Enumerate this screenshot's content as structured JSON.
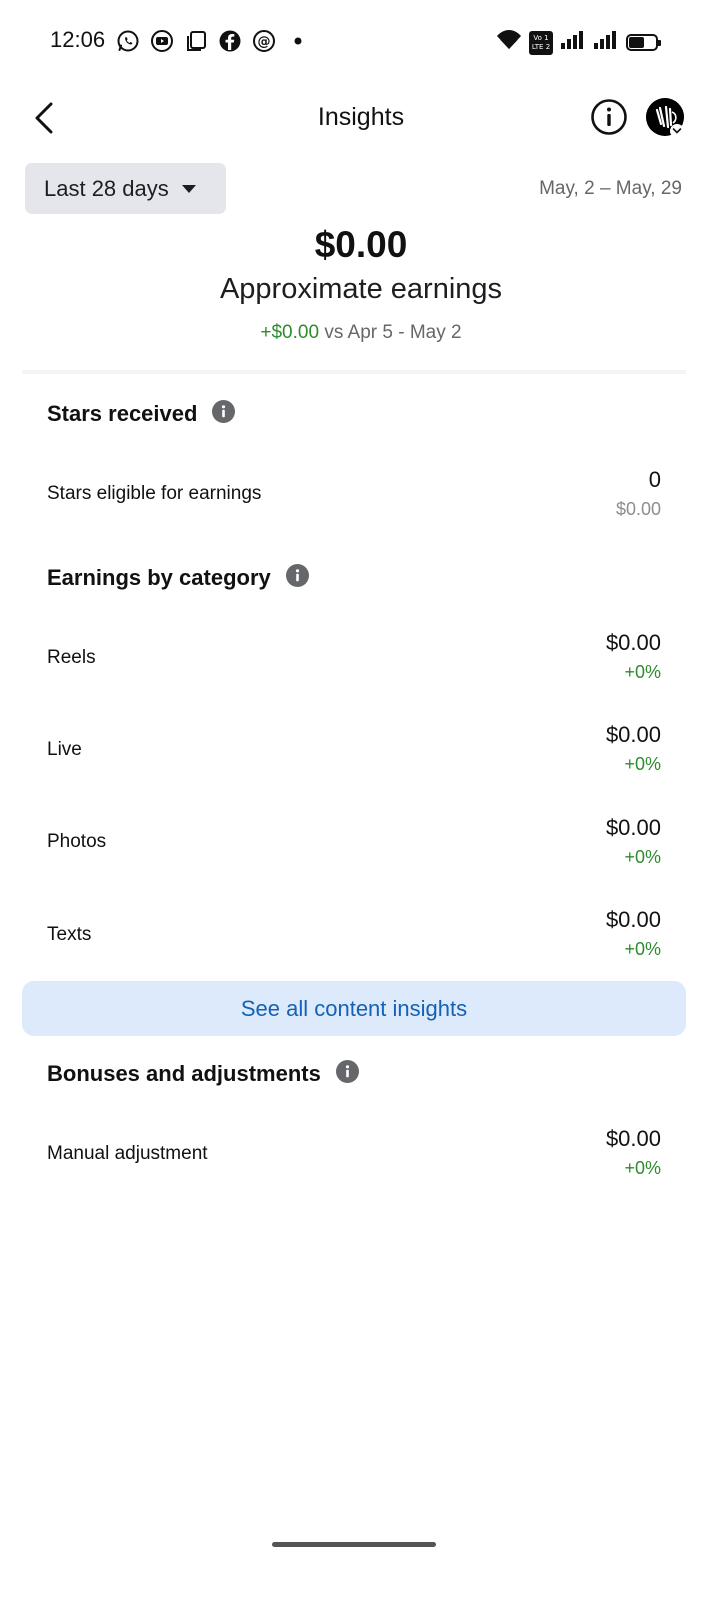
{
  "status_bar": {
    "time": "12:06",
    "left_icons": [
      "whatsapp-icon",
      "youtube-icon",
      "copy-icon",
      "facebook-icon",
      "threads-icon",
      "dot-icon"
    ],
    "right_icons": [
      "wifi-icon",
      "volte-icon",
      "signal-icon",
      "signal-icon",
      "battery-icon"
    ],
    "volte_line1": "Vo 1",
    "volte_line2": "LTE 2",
    "battery_level": 0.55
  },
  "header": {
    "title": "Insights",
    "back_icon": "chevron-left-icon",
    "info_icon": "info-icon"
  },
  "filters": {
    "range_label": "Last 28 days",
    "date_range": "May, 2 – May, 29"
  },
  "summary": {
    "amount": "$0.00",
    "label": "Approximate earnings",
    "change": "+$0.00",
    "compare_text": "vs Apr 5 - May 2"
  },
  "stars": {
    "heading": "Stars received",
    "row_label": "Stars eligible for earnings",
    "count": "0",
    "value": "$0.00"
  },
  "categories": {
    "heading": "Earnings by category",
    "items": [
      {
        "label": "Reels",
        "value": "$0.00",
        "change": "+0%"
      },
      {
        "label": "Live",
        "value": "$0.00",
        "change": "+0%"
      },
      {
        "label": "Photos",
        "value": "$0.00",
        "change": "+0%"
      },
      {
        "label": "Texts",
        "value": "$0.00",
        "change": "+0%"
      }
    ]
  },
  "cta": {
    "label": "See all content insights"
  },
  "bonuses": {
    "heading": "Bonuses and adjustments",
    "row_label": "Manual adjustment",
    "value": "$0.00",
    "change": "+0%"
  },
  "colors": {
    "positive": "#2e8b2e",
    "link": "#1461b5",
    "cta_background": "#dceafb",
    "pill_background": "#e4e6eb",
    "secondary_text": "#65676b"
  }
}
